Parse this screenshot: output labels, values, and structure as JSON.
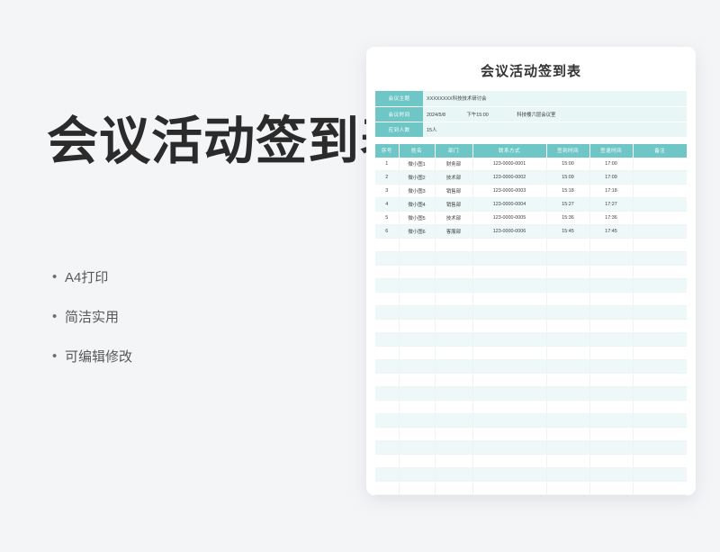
{
  "promo": {
    "title": "会议活动签到表",
    "bullet_glyph": "•",
    "features": [
      "A4打印",
      "简洁实用",
      "可编辑修改"
    ]
  },
  "document": {
    "title": "会议活动签到表",
    "info_rows": [
      {
        "label": "会议主题",
        "value": "XXXXXXXX科技技术研讨会",
        "time": "",
        "place": ""
      },
      {
        "label": "会议时间",
        "value": "2024/5/8",
        "time": "下午15:00",
        "place": "科技楼六层会议室"
      },
      {
        "label": "应到人数",
        "value": "15人",
        "time": "",
        "place": ""
      }
    ],
    "table": {
      "columns": [
        "序号",
        "姓名",
        "部门",
        "联系方式",
        "签到时间",
        "签退时间",
        "备注"
      ],
      "rows": [
        [
          "1",
          "微小图1",
          "财务部",
          "123-0000-0001",
          "15:00",
          "17:00",
          ""
        ],
        [
          "2",
          "微小图2",
          "技术部",
          "123-0000-0002",
          "15:09",
          "17:09",
          ""
        ],
        [
          "3",
          "微小图3",
          "销售部",
          "123-0000-0003",
          "15:18",
          "17:18",
          ""
        ],
        [
          "4",
          "微小图4",
          "销售部",
          "123-0000-0004",
          "15:27",
          "17:27",
          ""
        ],
        [
          "5",
          "微小图5",
          "技术部",
          "123-0000-0005",
          "15:36",
          "17:36",
          ""
        ],
        [
          "6",
          "微小图6",
          "客服部",
          "123-0000-0006",
          "15:45",
          "17:45",
          ""
        ]
      ],
      "empty_row_count": 21
    }
  },
  "colors": {
    "page_background": "#f4f5f7",
    "card_background": "#ffffff",
    "accent_teal": "#6ec6c6",
    "info_value_background": "#e9f6f6",
    "row_stripe": "#eef8f8",
    "title_text": "#2b2b2b",
    "body_text": "#3c3c3c"
  }
}
